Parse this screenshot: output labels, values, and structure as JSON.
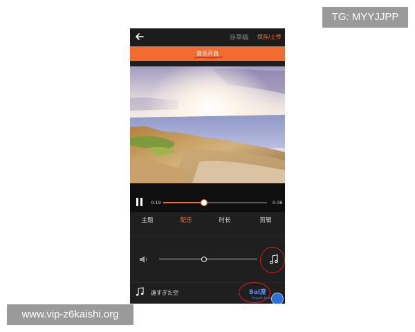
{
  "watermarks": {
    "top": "TG: MYYJJPP",
    "bottom": "www.vip-z6kaishi.org"
  },
  "topbar": {
    "draft_label": "存草稿",
    "save_label": "保存/上传"
  },
  "banner": {
    "label": "音乐开启"
  },
  "player": {
    "current_time": "0:19",
    "total_time": "0:36",
    "progress": 0.39
  },
  "tabs": [
    {
      "label": "主题",
      "active": false
    },
    {
      "label": "配乐",
      "active": true
    },
    {
      "label": "时长",
      "active": false
    },
    {
      "label": "剪辑",
      "active": false
    }
  ],
  "volume": {
    "level": 0.46
  },
  "music": {
    "track_name": "遠すぎた空"
  },
  "overlays": {
    "logo_text": "Bai度",
    "logo_subtext": "jingyan.baidu.com"
  },
  "colors": {
    "accent": "#f26b2f",
    "background": "#1f1f1f",
    "annotation": "#e01a1a"
  },
  "icons": {
    "back": "back-arrow-icon",
    "pause": "pause-icon",
    "volume": "speaker-icon",
    "music": "music-note-icon"
  }
}
